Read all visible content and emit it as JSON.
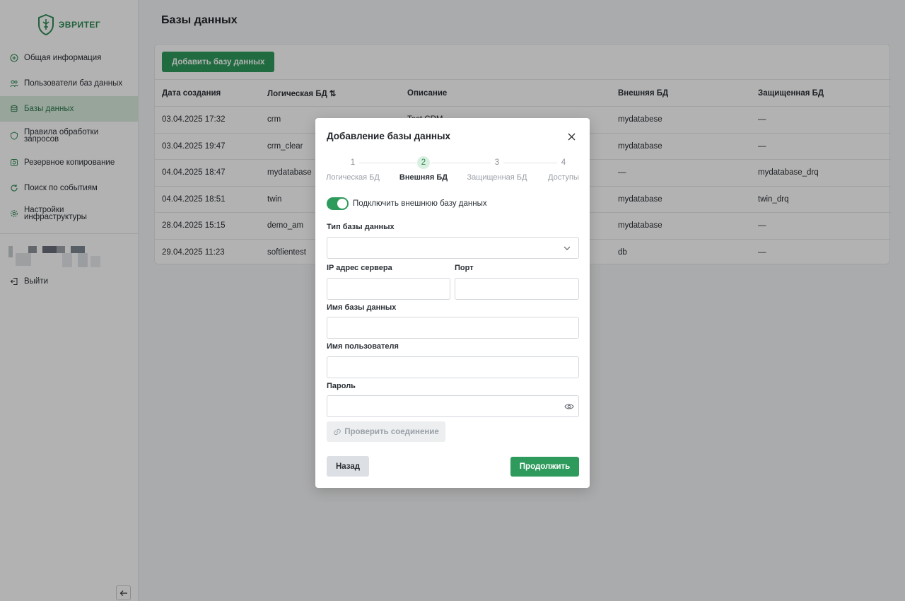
{
  "brand": {
    "name": "ЭВРИТЕГ",
    "color": "#2f8a55"
  },
  "colors": {
    "accent": "#2e9b5c",
    "active_bg": "#d9ecdf"
  },
  "sidebar": {
    "items": [
      {
        "label": "Общая информация",
        "icon": "info-circle-icon"
      },
      {
        "label": "Пользователи баз данных",
        "icon": "users-icon"
      },
      {
        "label": "Базы данных",
        "icon": "database-icon",
        "active": true
      },
      {
        "label": "Правила обработки запросов",
        "icon": "shield-icon"
      },
      {
        "label": "Резервное копирование",
        "icon": "backup-icon"
      },
      {
        "label": "Поиск по событиям",
        "icon": "search-refresh-icon"
      },
      {
        "label": "Настройки инфраструктуры",
        "icon": "gear-icon"
      }
    ],
    "logout": "Выйти"
  },
  "main": {
    "title": "Базы данных",
    "add_button": "Добавить базу данных",
    "table": {
      "headers": [
        "Дата создания",
        "Логическая БД",
        "Описание",
        "Внешняя БД",
        "Защищенная БД"
      ],
      "rows": [
        [
          "03.04.2025 17:32",
          "crm",
          "Test CRM",
          "mydatabese",
          "—"
        ],
        [
          "03.04.2025 19:47",
          "crm_clear",
          "",
          "mydatabase",
          "—"
        ],
        [
          "04.04.2025 18:47",
          "mydatabase",
          "",
          "—",
          "mydatabase_drq"
        ],
        [
          "04.04.2025 18:51",
          "twin",
          "",
          "mydatabase",
          "twin_drq"
        ],
        [
          "28.04.2025 15:15",
          "demo_am",
          "",
          "mydatabase",
          "—"
        ],
        [
          "29.04.2025 11:23",
          "softlientest",
          "",
          "db",
          "—"
        ]
      ]
    }
  },
  "modal": {
    "title": "Добавление базы данных",
    "steps": [
      {
        "num": "1",
        "label": "Логическая БД"
      },
      {
        "num": "2",
        "label": "Внешняя БД",
        "active": true
      },
      {
        "num": "3",
        "label": "Защищенная БД"
      },
      {
        "num": "4",
        "label": "Доступы"
      }
    ],
    "toggle_label": "Подключить внешнюю базу данных",
    "toggle_on": true,
    "fields": {
      "db_type": {
        "label": "Тип базы данных",
        "value": ""
      },
      "server_ip": {
        "label": "IP адрес сервера",
        "value": ""
      },
      "port": {
        "label": "Порт",
        "value": ""
      },
      "db_name": {
        "label": "Имя базы данных",
        "value": ""
      },
      "username": {
        "label": "Имя пользователя",
        "value": ""
      },
      "password": {
        "label": "Пароль",
        "value": ""
      }
    },
    "check_button": "Проверить соединение",
    "back_button": "Назад",
    "continue_button": "Продолжить"
  }
}
